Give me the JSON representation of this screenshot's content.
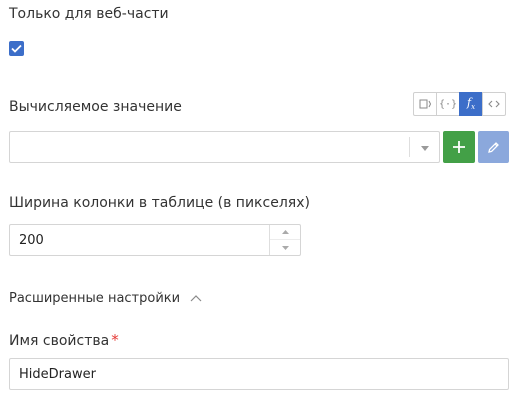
{
  "web_only": {
    "label": "Только для веб-части",
    "checked": true
  },
  "computed": {
    "label": "Вычисляемое значение",
    "modes": [
      {
        "icon": "input-icon",
        "glyph": "▯",
        "active": false
      },
      {
        "icon": "braces-icon",
        "glyph": "{ }",
        "active": false
      },
      {
        "icon": "function-icon",
        "glyph": "f",
        "active": true
      },
      {
        "icon": "code-icon",
        "glyph": "<>",
        "active": false
      }
    ],
    "select_value": "",
    "add_icon": "plus-icon",
    "edit_icon": "pencil-icon",
    "colors": {
      "add": "#43a047",
      "edit": "#8ba8dc",
      "active": "#3c6ec9"
    }
  },
  "column_width": {
    "label": "Ширина колонки в таблице (в пикселях)",
    "value": "200"
  },
  "advanced": {
    "label": "Расширенные настройки",
    "expanded": true
  },
  "property_name": {
    "label": "Имя свойства",
    "required_mark": "*",
    "value": "HideDrawer"
  }
}
